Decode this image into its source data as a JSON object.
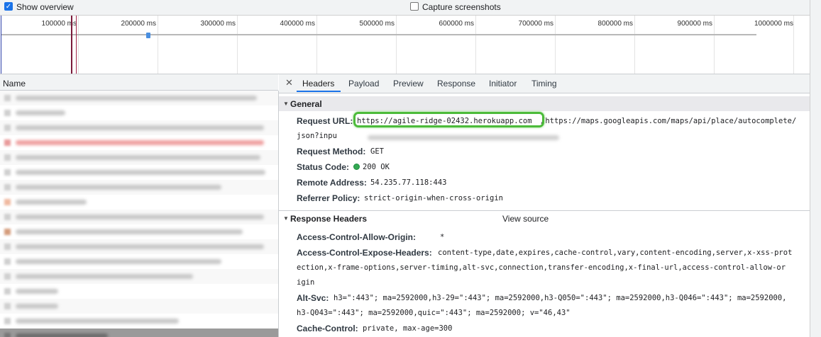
{
  "toolbar": {
    "show_overview_label": "Show overview",
    "show_overview_checked": true,
    "capture_screenshots_label": "Capture screenshots",
    "capture_screenshots_checked": false
  },
  "overview": {
    "ticks": [
      "100000 ms",
      "200000 ms",
      "300000 ms",
      "400000 ms",
      "500000 ms",
      "600000 ms",
      "700000 ms",
      "800000 ms",
      "900000 ms",
      "1000000 ms"
    ]
  },
  "request_list": {
    "column_name": "Name"
  },
  "tabs": [
    {
      "label": "Headers",
      "active": true
    },
    {
      "label": "Payload",
      "active": false
    },
    {
      "label": "Preview",
      "active": false
    },
    {
      "label": "Response",
      "active": false
    },
    {
      "label": "Initiator",
      "active": false
    },
    {
      "label": "Timing",
      "active": false
    }
  ],
  "general": {
    "title": "General",
    "request_url_key": "Request URL:",
    "request_url_highlight": "https://agile-ridge-02432.herokuapp.com",
    "request_url_rest": "/https://maps.googleapis.com/maps/api/place/autocomplete/",
    "request_url_line2": "json?inpu",
    "request_method_key": "Request Method:",
    "request_method_val": "GET",
    "status_code_key": "Status Code:",
    "status_code_val": "200 OK",
    "remote_address_key": "Remote Address:",
    "remote_address_val": "54.235.77.118:443",
    "referrer_policy_key": "Referrer Policy:",
    "referrer_policy_val": "strict-origin-when-cross-origin"
  },
  "response_headers": {
    "title": "Response Headers",
    "view_source": "View source",
    "acao_key": "Access-Control-Allow-Origin:",
    "acao_val": "*",
    "aceh_key": "Access-Control-Expose-Headers:",
    "aceh_val_1": "content-type,date,expires,cache-control,vary,content-encoding,server,x-xss-prot",
    "aceh_val_2": "ection,x-frame-options,server-timing,alt-svc,connection,transfer-encoding,x-final-url,access-control-allow-or",
    "aceh_val_3": "igin",
    "altsvc_key": "Alt-Svc:",
    "altsvc_val_1": "h3=\":443\"; ma=2592000,h3-29=\":443\"; ma=2592000,h3-Q050=\":443\"; ma=2592000,h3-Q046=\":443\"; ma=2592000,",
    "altsvc_val_2": "h3-Q043=\":443\"; ma=2592000,quic=\":443\"; ma=2592000; v=\"46,43\"",
    "cache_key": "Cache-Control:",
    "cache_val": "private, max-age=300"
  }
}
